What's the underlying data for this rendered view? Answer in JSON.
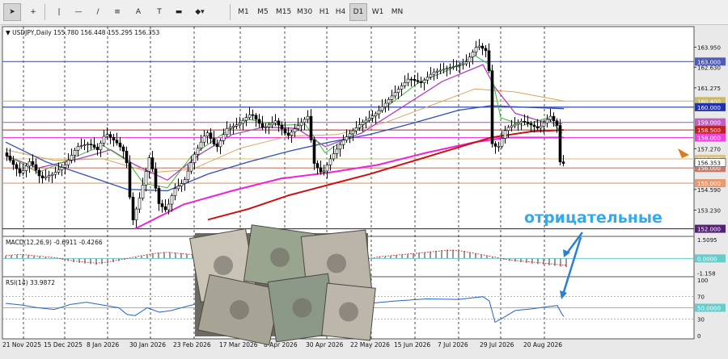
{
  "toolbar": {
    "tools": [
      {
        "name": "cursor-tool-icon",
        "glyph": "➤",
        "active": true
      },
      {
        "name": "crosshair-tool-icon",
        "glyph": "+",
        "active": false
      },
      {
        "name": "vertical-line-tool-icon",
        "glyph": "|",
        "active": false
      },
      {
        "name": "horizontal-line-tool-icon",
        "glyph": "—",
        "active": false
      },
      {
        "name": "trendline-tool-icon",
        "glyph": "/",
        "active": false
      },
      {
        "name": "channel-tool-icon",
        "glyph": "≡",
        "active": false
      },
      {
        "name": "text-tool-icon",
        "glyph": "A",
        "active": false
      },
      {
        "name": "text-label-tool-icon",
        "glyph": "T",
        "active": false
      },
      {
        "name": "rectangle-tool-icon",
        "glyph": "▬",
        "active": false
      },
      {
        "name": "shapes-tool-icon",
        "glyph": "◆▾",
        "active": false
      }
    ],
    "timeframes": [
      "M1",
      "M5",
      "M15",
      "M30",
      "H1",
      "H4",
      "D1",
      "W1",
      "MN"
    ],
    "active_timeframe": "D1"
  },
  "chart_data": {
    "type": "candlestick",
    "header": "USDJPY,Daily  155.780 156.448 155.295 156.353",
    "annotation": "отрицательные",
    "ylim": [
      151.5,
      165.3
    ],
    "yticks": [
      "163.950",
      "162.630",
      "161.275",
      "157.270",
      "154.590",
      "153.230"
    ],
    "price_levels": [
      {
        "price": 163.0,
        "label": "163.000",
        "color": "#4f5bb8",
        "text_color": "#ffffff"
      },
      {
        "price": 160.4,
        "label": "160.400",
        "color": "#c9b96a",
        "text_color": "#ffffff"
      },
      {
        "price": 160.0,
        "label": "160.000",
        "color": "#2233aa",
        "text_color": "#ffffff"
      },
      {
        "price": 159.0,
        "label": "159.000",
        "color": "#c060c0",
        "text_color": "#ffffff"
      },
      {
        "price": 158.5,
        "label": "158.500",
        "color": "#c02222",
        "text_color": "#ffffff"
      },
      {
        "price": 158.0,
        "label": "158.000",
        "color": "#ee44dd",
        "text_color": "#ffffff"
      },
      {
        "price": 156.6,
        "label": "156.600",
        "color": "#d9c48a",
        "text_color": "#ffffff"
      },
      {
        "price": 156.0,
        "label": "156.000",
        "color": "#c87a6a",
        "text_color": "#ffffff"
      },
      {
        "price": 155.0,
        "label": "155.000",
        "color": "#e79a70",
        "text_color": "#ffffff"
      },
      {
        "price": 152.0,
        "label": "152.000",
        "color": "#552277",
        "text_color": "#ffffff"
      }
    ],
    "current_price": {
      "price": 156.353,
      "label": "156.353"
    },
    "xticks": [
      "21 Nov 2025",
      "15 Dec 2025",
      "8 Jan 2026",
      "30 Jan 2026",
      "23 Feb 2026",
      "17 Mar 2026",
      "8 Apr 2026",
      "30 Apr 2026",
      "22 May 2026",
      "15 Jun 2026",
      "7 Jul 2026",
      "29 Jul 2026",
      "20 Aug 2026"
    ],
    "price_path": [
      [
        0,
        157.0
      ],
      [
        10,
        156.3
      ],
      [
        20,
        155.6
      ],
      [
        32,
        156.5
      ],
      [
        45,
        155.3
      ],
      [
        60,
        155.6
      ],
      [
        75,
        156.2
      ],
      [
        90,
        157.4
      ],
      [
        105,
        157.6
      ],
      [
        115,
        157.2
      ],
      [
        125,
        158.3
      ],
      [
        140,
        157.6
      ],
      [
        150,
        156.9
      ],
      [
        158,
        152.4
      ],
      [
        168,
        154.2
      ],
      [
        180,
        156.9
      ],
      [
        190,
        153.7
      ],
      [
        200,
        153.2
      ],
      [
        210,
        154.6
      ],
      [
        222,
        155.1
      ],
      [
        235,
        156.9
      ],
      [
        250,
        158.4
      ],
      [
        262,
        157.3
      ],
      [
        275,
        158.6
      ],
      [
        290,
        158.9
      ],
      [
        305,
        159.6
      ],
      [
        320,
        158.6
      ],
      [
        335,
        159.1
      ],
      [
        350,
        158.1
      ],
      [
        365,
        158.9
      ],
      [
        375,
        159.4
      ],
      [
        383,
        156.3
      ],
      [
        393,
        155.6
      ],
      [
        405,
        156.8
      ],
      [
        420,
        157.9
      ],
      [
        440,
        158.9
      ],
      [
        460,
        159.6
      ],
      [
        480,
        160.8
      ],
      [
        500,
        161.9
      ],
      [
        515,
        161.6
      ],
      [
        530,
        162.3
      ],
      [
        550,
        162.6
      ],
      [
        570,
        162.9
      ],
      [
        585,
        164.1
      ],
      [
        598,
        163.6
      ],
      [
        603,
        157.6
      ],
      [
        610,
        157.3
      ],
      [
        620,
        158.6
      ],
      [
        640,
        159.1
      ],
      [
        660,
        158.6
      ],
      [
        675,
        159.4
      ],
      [
        683,
        158.8
      ],
      [
        688,
        155.8
      ],
      [
        690,
        156.3
      ]
    ],
    "ma_fast": [
      [
        0,
        156.9
      ],
      [
        40,
        155.7
      ],
      [
        80,
        156.6
      ],
      [
        120,
        157.5
      ],
      [
        150,
        156.5
      ],
      [
        170,
        155.0
      ],
      [
        200,
        154.7
      ],
      [
        230,
        156.8
      ],
      [
        270,
        158.3
      ],
      [
        300,
        159.2
      ],
      [
        340,
        158.8
      ],
      [
        370,
        158.9
      ],
      [
        395,
        157.0
      ],
      [
        430,
        158.3
      ],
      [
        470,
        160.0
      ],
      [
        510,
        161.6
      ],
      [
        550,
        162.5
      ],
      [
        580,
        163.4
      ],
      [
        598,
        162.8
      ],
      [
        612,
        159.3
      ],
      [
        640,
        158.8
      ],
      [
        670,
        159.3
      ],
      [
        688,
        158.3
      ]
    ],
    "ma_mid": [
      [
        0,
        156.8
      ],
      [
        40,
        156.0
      ],
      [
        90,
        156.6
      ],
      [
        130,
        157.2
      ],
      [
        160,
        156.2
      ],
      [
        200,
        155.2
      ],
      [
        240,
        156.9
      ],
      [
        280,
        158.2
      ],
      [
        320,
        158.7
      ],
      [
        360,
        158.6
      ],
      [
        395,
        157.4
      ],
      [
        440,
        158.3
      ],
      [
        490,
        160.0
      ],
      [
        540,
        161.7
      ],
      [
        590,
        162.8
      ],
      [
        605,
        161.3
      ],
      [
        630,
        159.6
      ],
      [
        660,
        159.1
      ],
      [
        688,
        158.9
      ]
    ],
    "ma_slow": [
      [
        0,
        157.2
      ],
      [
        60,
        156.5
      ],
      [
        120,
        156.6
      ],
      [
        180,
        155.7
      ],
      [
        230,
        155.9
      ],
      [
        290,
        157.3
      ],
      [
        350,
        158.1
      ],
      [
        410,
        158.2
      ],
      [
        470,
        159.0
      ],
      [
        530,
        160.2
      ],
      [
        580,
        161.2
      ],
      [
        630,
        161.0
      ],
      [
        690,
        160.4
      ]
    ],
    "ma_blue": [
      [
        0,
        157.7
      ],
      [
        50,
        156.4
      ],
      [
        100,
        155.5
      ],
      [
        150,
        154.6
      ],
      [
        200,
        154.5
      ],
      [
        250,
        155.6
      ],
      [
        300,
        156.4
      ],
      [
        350,
        157.1
      ],
      [
        400,
        157.7
      ],
      [
        450,
        158.2
      ],
      [
        500,
        158.9
      ],
      [
        560,
        159.8
      ],
      [
        600,
        160.1
      ],
      [
        640,
        160.0
      ],
      [
        690,
        159.9
      ]
    ],
    "ma_magenta": [
      [
        160,
        152.0
      ],
      [
        220,
        153.6
      ],
      [
        280,
        154.5
      ],
      [
        340,
        155.3
      ],
      [
        400,
        155.7
      ],
      [
        460,
        156.2
      ],
      [
        520,
        157.0
      ],
      [
        580,
        157.7
      ],
      [
        620,
        158.0
      ],
      [
        690,
        158.0
      ]
    ],
    "ma_red": [
      [
        250,
        152.6
      ],
      [
        300,
        153.3
      ],
      [
        350,
        154.2
      ],
      [
        400,
        154.9
      ],
      [
        450,
        155.6
      ],
      [
        500,
        156.4
      ],
      [
        550,
        157.2
      ],
      [
        600,
        158.0
      ],
      [
        650,
        158.4
      ],
      [
        690,
        158.5
      ]
    ],
    "macd": {
      "header": "MACD(12,26,9) -0.6911 -0.4266",
      "ylim": [
        -1.45,
        1.75
      ],
      "yticks": [
        "1.5095",
        "-1.158"
      ],
      "zero_label": "0.0000",
      "hist": [
        0.2,
        0.25,
        0.3,
        0.3,
        0.25,
        0.2,
        0.15,
        0.1,
        0.05,
        0.0,
        -0.1,
        -0.2,
        -0.3,
        -0.35,
        -0.4,
        -0.45,
        -0.5,
        -0.45,
        -0.4,
        -0.3,
        -0.2,
        -0.1,
        0.0,
        0.1,
        0.2,
        0.3,
        0.4,
        0.45,
        0.5,
        0.5,
        0.45,
        0.4,
        0.35,
        0.3,
        0.2,
        0.1,
        0.0,
        -0.1,
        -0.15,
        -0.1,
        0.0,
        0.1,
        0.2,
        0.25,
        0.3,
        0.35,
        0.4,
        0.45,
        0.5,
        0.55,
        0.6,
        0.55,
        0.5,
        0.45,
        0.4,
        0.35,
        0.3,
        0.25,
        0.2,
        0.15,
        0.1,
        0.05,
        0.0,
        -0.05,
        -0.05,
        0.0,
        0.1,
        0.15,
        0.2,
        0.25,
        0.3,
        0.35,
        0.4,
        0.45,
        0.5,
        0.55,
        0.6,
        0.65,
        0.7,
        0.7,
        0.65,
        0.6,
        0.5,
        0.4,
        0.3,
        0.2,
        0.1,
        0.0,
        -0.1,
        -0.2,
        -0.25,
        -0.3,
        -0.35,
        -0.4,
        -0.45,
        -0.5,
        -0.55,
        -0.6,
        -0.65,
        -0.69
      ]
    },
    "rsi": {
      "header": "RSI(14) 33.9872",
      "ylim": [
        0,
        100
      ],
      "yticks": [
        "100",
        "70",
        "30",
        "0"
      ],
      "level_label": "50.0000",
      "values": [
        [
          0,
          58
        ],
        [
          20,
          55
        ],
        [
          40,
          50
        ],
        [
          60,
          47
        ],
        [
          80,
          56
        ],
        [
          100,
          60
        ],
        [
          120,
          55
        ],
        [
          140,
          50
        ],
        [
          150,
          38
        ],
        [
          160,
          36
        ],
        [
          175,
          50
        ],
        [
          190,
          42
        ],
        [
          205,
          45
        ],
        [
          225,
          53
        ],
        [
          245,
          60
        ],
        [
          260,
          55
        ],
        [
          280,
          58
        ],
        [
          300,
          62
        ],
        [
          320,
          56
        ],
        [
          340,
          58
        ],
        [
          360,
          62
        ],
        [
          375,
          60
        ],
        [
          385,
          40
        ],
        [
          400,
          45
        ],
        [
          420,
          55
        ],
        [
          450,
          58
        ],
        [
          480,
          62
        ],
        [
          520,
          66
        ],
        [
          560,
          65
        ],
        [
          590,
          70
        ],
        [
          598,
          62
        ],
        [
          605,
          24
        ],
        [
          615,
          32
        ],
        [
          630,
          45
        ],
        [
          650,
          48
        ],
        [
          670,
          52
        ],
        [
          682,
          54
        ],
        [
          688,
          38
        ],
        [
          690,
          34
        ]
      ]
    }
  }
}
